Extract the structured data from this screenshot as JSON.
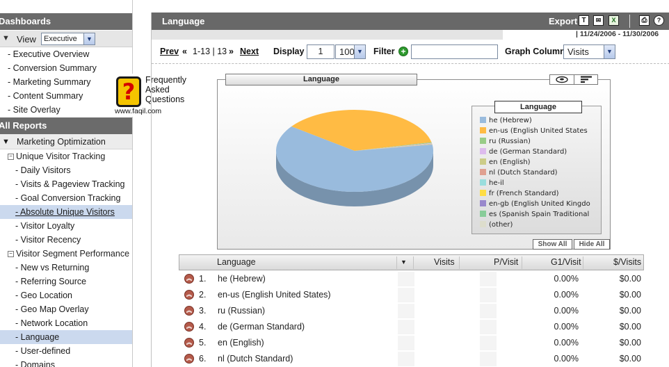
{
  "sidebar": {
    "dashboards_label": "Dashboards",
    "view_label": "View",
    "view_value": "Executive",
    "dashboard_items": [
      "- Executive Overview",
      "- Conversion Summary",
      "- Marketing Summary",
      "- Content Summary",
      "- Site Overlay"
    ],
    "all_reports_label": "All Reports",
    "group_label": "Marketing Optimization",
    "sub1_label": "Unique Visitor Tracking",
    "sub1_items": [
      "- Daily Visitors",
      "- Visits & Pageview Tracking",
      "- Goal Conversion Tracking",
      "- Absolute Unique Visitors ",
      "- Visitor Loyalty",
      "- Visitor Recency"
    ],
    "sub2_label": "Visitor Segment Performance",
    "sub2_items": [
      "- New vs Returning",
      "- Referring Source",
      "- Geo Location",
      "- Geo Map Overlay",
      "- Network Location",
      "- Language",
      "- User-defined",
      "- Domains"
    ]
  },
  "faq": {
    "line1": "Frequently",
    "line2": "Asked",
    "line3": "Questions",
    "url": "www.faqil.com"
  },
  "header": {
    "title": "Language",
    "export_label": "Export",
    "date_range": "|  11/24/2006 - 11/30/2006"
  },
  "toolbar": {
    "prev": "Prev",
    "range": "1-13 | 13",
    "next": "Next",
    "display_label": "Display",
    "display_value": "1",
    "per_page": "100",
    "filter_label": "Filter",
    "filter_value": "",
    "graph_label": "Graph Column",
    "graph_value": "Visits"
  },
  "chart_data": {
    "type": "pie",
    "title": "Language",
    "legend_title": "Language",
    "legend_placement": "right",
    "categories": [
      "he (Hebrew)",
      "en-us (English United States",
      "ru (Russian)",
      "de (German Standard)",
      "en (English)",
      "nl (Dutch Standard)",
      "he-il",
      "fr (French Standard)",
      "en-gb (English United Kingdo",
      "es (Spanish Spain Traditional",
      "(other)"
    ],
    "values": [
      62.5,
      36.5,
      0.3,
      0.2,
      0.2,
      0.1,
      0.05,
      0.05,
      0.05,
      0.03,
      0.02
    ],
    "colors": [
      "#99bbdd",
      "#ffbb44",
      "#99cc88",
      "#ddbbee",
      "#cccc88",
      "#e0a090",
      "#99dddd",
      "#ffdd44",
      "#9988cc",
      "#88cc99",
      "#ddddcc"
    ]
  },
  "chart_buttons": {
    "show_all": "Show All",
    "hide_all": "Hide All"
  },
  "table": {
    "columns": [
      "Language",
      "Visits",
      "P/Visit",
      "G1/Visit",
      "$/Visits"
    ],
    "rows": [
      {
        "num": "1.",
        "language": "he (Hebrew)",
        "g1": "0.00%",
        "dollar": "$0.00"
      },
      {
        "num": "2.",
        "language": "en-us (English United States)",
        "g1": "0.00%",
        "dollar": "$0.00"
      },
      {
        "num": "3.",
        "language": "ru (Russian)",
        "g1": "0.00%",
        "dollar": "$0.00"
      },
      {
        "num": "4.",
        "language": "de (German Standard)",
        "g1": "0.00%",
        "dollar": "$0.00"
      },
      {
        "num": "5.",
        "language": "en (English)",
        "g1": "0.00%",
        "dollar": "$0.00"
      },
      {
        "num": "6.",
        "language": "nl (Dutch Standard)",
        "g1": "0.00%",
        "dollar": "$0.00"
      }
    ]
  }
}
